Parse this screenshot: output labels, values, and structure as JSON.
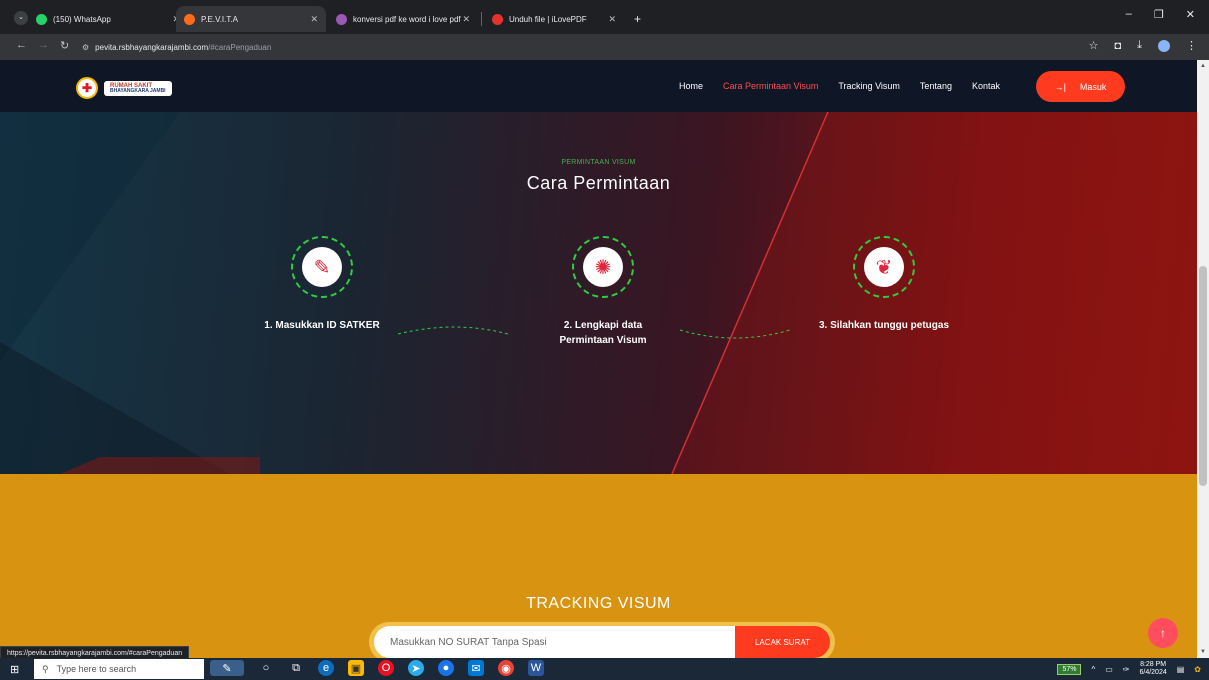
{
  "browser": {
    "tabs": [
      {
        "title": "(150) WhatsApp",
        "favicon_color": "#25d366",
        "active": false
      },
      {
        "title": "P.E.V.I.T.A",
        "favicon_color": "#ff6b1a",
        "active": true
      },
      {
        "title": "konversi pdf ke word i love pdf",
        "favicon_color": "#9b59b6",
        "active": false
      },
      {
        "title": "Unduh file | iLovePDF",
        "favicon_color": "#e5322d",
        "active": false
      }
    ],
    "new_tab_label": "+",
    "address": {
      "host": "pevita.rsbhayangkarajambi.com",
      "path": "/#caraPengaduan"
    },
    "status_url": "https://pevita.rsbhayangkarajambi.com/#caraPengaduan"
  },
  "site": {
    "logo": {
      "line1": "RUMAH SAKIT",
      "line2": "BHAYANGKARA JAMBI"
    },
    "nav": [
      {
        "label": "Home",
        "active": false
      },
      {
        "label": "Cara Permintaan Visum",
        "active": true
      },
      {
        "label": "Tracking Visum",
        "active": false
      },
      {
        "label": "Tentang",
        "active": false
      },
      {
        "label": "Kontak",
        "active": false
      }
    ],
    "login_button": "Masuk",
    "accent_color": "#ff3b1f"
  },
  "hero": {
    "eyebrow": "PERMINTAAN VISUM",
    "title": "Cara Permintaan",
    "steps": [
      {
        "label": "1. Masukkan ID SATKER",
        "icon": "document-icon"
      },
      {
        "label": "2. Lengkapi data Permintaan Visum",
        "icon": "lightbulb-hand-icon"
      },
      {
        "label": "3. Silahkan tunggu petugas",
        "icon": "handshake-icon"
      }
    ]
  },
  "tracking": {
    "title": "TRACKING VISUM",
    "input_placeholder": "Masukkan NO SURAT Tanpa Spasi",
    "input_value": "",
    "button_label": "LACAK SURAT",
    "background_color": "#d89410"
  },
  "taskbar": {
    "search_placeholder": "Type here to search",
    "battery": "57%",
    "time": "8:28 PM",
    "date": "6/4/2024"
  }
}
